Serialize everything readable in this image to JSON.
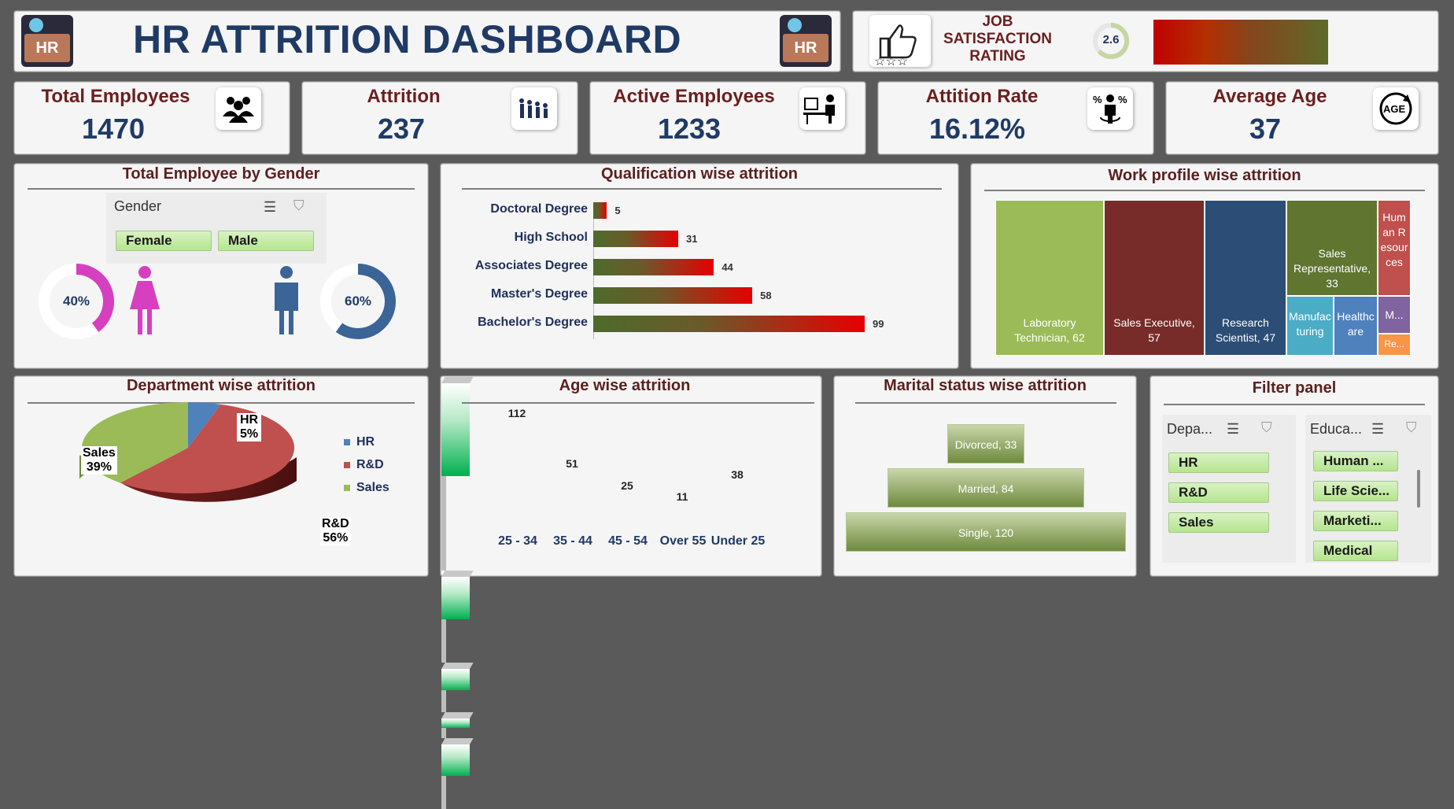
{
  "header": {
    "title": "HR ATTRITION DASHBOARD",
    "logo_text": "HR"
  },
  "job_satisfaction": {
    "label_line1": "JOB",
    "label_line2": "SATISFACTION",
    "label_line3": "RATING",
    "rating": "2.6"
  },
  "kpis": [
    {
      "label": "Total Employees",
      "value": "1470",
      "icon": "people-group-icon"
    },
    {
      "label": "Attrition",
      "value": "237",
      "icon": "people-leaving-icon"
    },
    {
      "label": "Active Employees",
      "value": "1233",
      "icon": "person-at-desk-icon"
    },
    {
      "label": "Attition Rate",
      "value": "16.12%",
      "icon": "percent-person-icon"
    },
    {
      "label": "Average Age",
      "value": "37",
      "icon": "age-cycle-icon",
      "icon_text": "AGE"
    }
  ],
  "gender": {
    "title": "Total Employee by Gender",
    "slicer_title": "Gender",
    "options": [
      "Female",
      "Male"
    ],
    "female_pct": "40%",
    "male_pct": "60%",
    "female_color": "#d63fc0",
    "male_color": "#3b6497"
  },
  "qualification": {
    "title": "Qualification wise attrition"
  },
  "work_profile": {
    "title": "Work profile wise attrition",
    "cells": [
      {
        "label": "Laboratory Technician, 62",
        "color": "#9bbb59"
      },
      {
        "label": "Sales Executive, 57",
        "color": "#772c2a"
      },
      {
        "label": "Research Scientist, 47",
        "color": "#2c4d75"
      },
      {
        "label": "Sales Representative, 33",
        "color": "#5f7530"
      },
      {
        "label": "Human Resources",
        "color": "#c0504d"
      },
      {
        "label": "Manufacturing",
        "color": "#4bacc6"
      },
      {
        "label": "Healthcare",
        "color": "#4f81bd"
      },
      {
        "label": "M...",
        "color": "#8064a2"
      },
      {
        "label": "Re...",
        "color": "#f79646"
      }
    ]
  },
  "department": {
    "title": "Department wise attrition",
    "labels": {
      "hr": "HR",
      "hr_pct": "5%",
      "rd": "R&D",
      "rd_pct": "56%",
      "sales": "Sales",
      "sales_pct": "39%"
    },
    "legend": [
      "HR",
      "R&D",
      "Sales"
    ]
  },
  "age": {
    "title": "Age wise attrition"
  },
  "marital": {
    "title": "Marital status wise attrition"
  },
  "filter": {
    "title": "Filter panel",
    "dept_head": "Depa...",
    "dept_options": [
      "HR",
      "R&D",
      "Sales"
    ],
    "edu_head": "Educa...",
    "edu_options": [
      "Human ...",
      "Life Scie...",
      "Marketi...",
      "Medical"
    ]
  },
  "chart_data": [
    {
      "type": "bar",
      "title": "Qualification wise attrition",
      "categories": [
        "Doctoral Degree",
        "High School",
        "Associates Degree",
        "Master's Degree",
        "Bachelor's Degree"
      ],
      "values": [
        5,
        31,
        44,
        58,
        99
      ]
    },
    {
      "type": "pie",
      "title": "Department wise attrition",
      "categories": [
        "HR",
        "R&D",
        "Sales"
      ],
      "values": [
        5,
        56,
        39
      ],
      "colors": [
        "#4f81bd",
        "#c0504d",
        "#9bbb59"
      ],
      "legend": "right"
    },
    {
      "type": "bar",
      "title": "Age wise attrition",
      "categories": [
        "25 - 34",
        "35 - 44",
        "45 - 54",
        "Over 55",
        "Under 25"
      ],
      "values": [
        112,
        51,
        25,
        11,
        38
      ]
    },
    {
      "type": "bar",
      "title": "Marital status wise attrition",
      "categories": [
        "Divorced",
        "Married",
        "Single"
      ],
      "values": [
        33,
        84,
        120
      ]
    },
    {
      "type": "heatmap",
      "title": "Work profile wise attrition",
      "categories": [
        "Laboratory Technician",
        "Sales Executive",
        "Research Scientist",
        "Sales Representative"
      ],
      "values": [
        62,
        57,
        47,
        33
      ]
    }
  ]
}
